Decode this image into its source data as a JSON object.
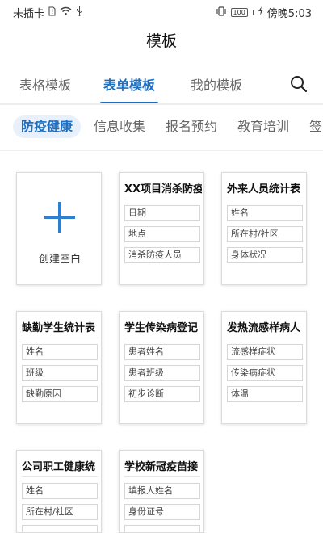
{
  "status_bar": {
    "carrier": "未插卡",
    "battery": "100",
    "time": "傍晚5:03"
  },
  "title": "模板",
  "top_tabs": [
    {
      "label": "表格模板",
      "active": false
    },
    {
      "label": "表单模板",
      "active": true
    },
    {
      "label": "我的模板",
      "active": false
    }
  ],
  "category_tabs": [
    {
      "label": "防疫健康",
      "active": true
    },
    {
      "label": "信息收集",
      "active": false
    },
    {
      "label": "报名预约",
      "active": false
    },
    {
      "label": "教育培训",
      "active": false
    },
    {
      "label": "签",
      "active": false
    }
  ],
  "create_blank": {
    "label": "创建空白"
  },
  "templates": [
    {
      "title": "XX项目消杀防疫",
      "fields": [
        "日期",
        "地点",
        "消杀防疫人员"
      ]
    },
    {
      "title": "外来人员统计表",
      "fields": [
        "姓名",
        "所在村/社区",
        "身体状况"
      ]
    },
    {
      "title": "缺勤学生统计表",
      "fields": [
        "姓名",
        "班级",
        "缺勤原因"
      ]
    },
    {
      "title": "学生传染病登记",
      "fields": [
        "患者姓名",
        "患者班级",
        "初步诊断"
      ]
    },
    {
      "title": "发热流感样病人",
      "fields": [
        "流感样症状",
        "传染病症状",
        "体温"
      ]
    },
    {
      "title": "公司职工健康统",
      "fields": [
        "姓名",
        "所在村/社区",
        ""
      ]
    },
    {
      "title": "学校新冠疫苗接",
      "fields": [
        "填报人姓名",
        "身份证号",
        ""
      ]
    }
  ],
  "icons": {
    "search": "search-icon",
    "plus": "plus-icon"
  },
  "colors": {
    "accent": "#1f6fc1",
    "active_pill_bg": "#e8f1fb"
  }
}
